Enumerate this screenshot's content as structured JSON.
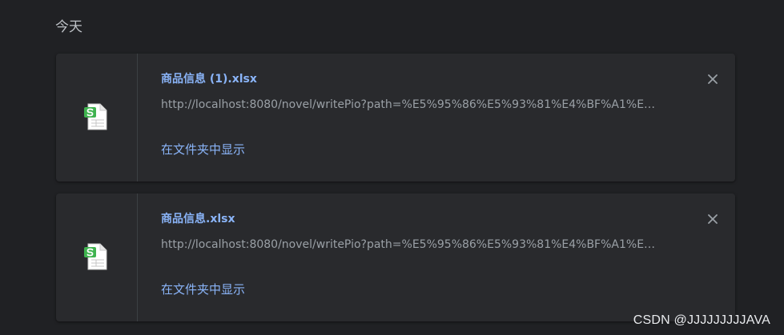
{
  "section": {
    "title": "今天"
  },
  "downloads": [
    {
      "file_name": "商品信息 (1).xlsx",
      "url": "http://localhost:8080/novel/writePio?path=%E5%95%86%E5%93%81%E4%BF%A1%E…",
      "show_in_folder_label": "在文件夹中显示",
      "icon": "spreadsheet-file-icon",
      "close_icon": "close-icon"
    },
    {
      "file_name": "商品信息.xlsx",
      "url": "http://localhost:8080/novel/writePio?path=%E5%95%86%E5%93%81%E4%BF%A1%E…",
      "show_in_folder_label": "在文件夹中显示",
      "icon": "spreadsheet-file-icon",
      "close_icon": "close-icon"
    }
  ],
  "watermark": {
    "text": "CSDN @JJJJJJJJJAVA"
  },
  "colors": {
    "background": "#202124",
    "card": "#292a2d",
    "link": "#8ab4f8",
    "secondary_text": "#9aa0a6",
    "icon_green": "#3fb34f"
  }
}
